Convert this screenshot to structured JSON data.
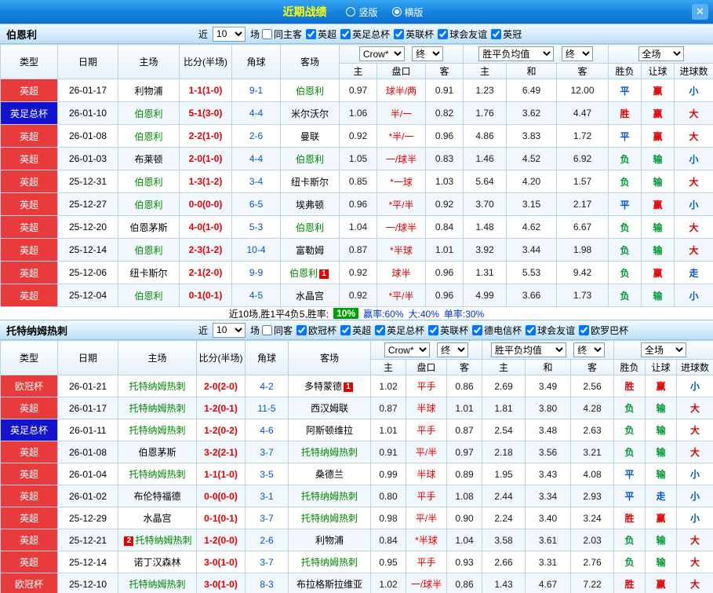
{
  "topbar": {
    "title": "近期战绩",
    "radios": [
      {
        "label": "竖版",
        "selected": false
      },
      {
        "label": "横版",
        "selected": true
      }
    ],
    "close": "✕"
  },
  "table_labels": {
    "col_type": "类型",
    "col_date": "日期",
    "col_home": "主场",
    "col_score": "比分(半场)",
    "col_corner": "角球",
    "col_away": "客场",
    "col_host": "主",
    "col_handicap": "盘口",
    "col_guest": "客",
    "col_draw": "和",
    "col_wdl": "胜负",
    "col_let": "让球",
    "col_goals": "进球数",
    "sel_bookmaker": "Crow*",
    "sel_final": "终",
    "sel_avg": "胜平负均值",
    "sel_scope": "全场",
    "near": "近",
    "games": "场"
  },
  "sections": [
    {
      "team": "伯恩利",
      "count": "10",
      "filters": [
        {
          "label": "同主客",
          "checked": false
        },
        {
          "label": "英超",
          "checked": true
        },
        {
          "label": "英足总杯",
          "checked": true
        },
        {
          "label": "英联杯",
          "checked": true
        },
        {
          "label": "球会友谊",
          "checked": true
        },
        {
          "label": "英冠",
          "checked": true
        }
      ],
      "rows": [
        {
          "league": "英超",
          "lc": "r",
          "date": "26-01-17",
          "home": "利物浦",
          "hf": 0,
          "score": "1-1(1-0)",
          "corner": "9-1",
          "away": "伯恩利",
          "af": 1,
          "o1": "0.97",
          "pk": "球半/两",
          "o2": "0.91",
          "e1": "1.23",
          "e2": "6.49",
          "e3": "12.00",
          "r1": [
            "平",
            "b"
          ],
          "r2": [
            "赢",
            "r"
          ],
          "r3": [
            "小",
            "b"
          ]
        },
        {
          "league": "英足总杯",
          "lc": "u",
          "date": "26-01-10",
          "home": "伯恩利",
          "hf": 1,
          "score": "5-1(3-0)",
          "corner": "4-4",
          "away": "米尔沃尔",
          "af": 0,
          "o1": "1.06",
          "pk": "半/一",
          "o2": "0.82",
          "e1": "1.76",
          "e2": "3.62",
          "e3": "4.47",
          "r1": [
            "胜",
            "r"
          ],
          "r2": [
            "赢",
            "r"
          ],
          "r3": [
            "大",
            "r"
          ]
        },
        {
          "league": "英超",
          "lc": "r",
          "date": "26-01-08",
          "home": "伯恩利",
          "hf": 1,
          "score": "2-2(1-0)",
          "corner": "2-6",
          "away": "曼联",
          "af": 0,
          "o1": "0.92",
          "pk": "*半/一",
          "o2": "0.96",
          "e1": "4.86",
          "e2": "3.83",
          "e3": "1.72",
          "r1": [
            "平",
            "b"
          ],
          "r2": [
            "赢",
            "r"
          ],
          "r3": [
            "大",
            "r"
          ]
        },
        {
          "league": "英超",
          "lc": "r",
          "date": "26-01-03",
          "home": "布莱顿",
          "hf": 0,
          "score": "2-0(1-0)",
          "corner": "4-4",
          "away": "伯恩利",
          "af": 1,
          "o1": "1.05",
          "pk": "一/球半",
          "o2": "0.83",
          "e1": "1.46",
          "e2": "4.52",
          "e3": "6.92",
          "r1": [
            "负",
            "g"
          ],
          "r2": [
            "输",
            "g"
          ],
          "r3": [
            "小",
            "b"
          ]
        },
        {
          "league": "英超",
          "lc": "r",
          "date": "25-12-31",
          "home": "伯恩利",
          "hf": 1,
          "score": "1-3(1-2)",
          "corner": "3-4",
          "away": "纽卡斯尔",
          "af": 0,
          "o1": "0.85",
          "pk": "*一球",
          "o2": "1.03",
          "e1": "5.64",
          "e2": "4.20",
          "e3": "1.57",
          "r1": [
            "负",
            "g"
          ],
          "r2": [
            "输",
            "g"
          ],
          "r3": [
            "大",
            "r"
          ]
        },
        {
          "league": "英超",
          "lc": "r",
          "date": "25-12-27",
          "home": "伯恩利",
          "hf": 1,
          "score": "0-0(0-0)",
          "corner": "6-5",
          "away": "埃弗顿",
          "af": 0,
          "o1": "0.96",
          "pk": "*平/半",
          "o2": "0.92",
          "e1": "3.70",
          "e2": "3.15",
          "e3": "2.17",
          "r1": [
            "平",
            "b"
          ],
          "r2": [
            "赢",
            "r"
          ],
          "r3": [
            "小",
            "b"
          ]
        },
        {
          "league": "英超",
          "lc": "r",
          "date": "25-12-20",
          "home": "伯恩茅斯",
          "hf": 0,
          "score": "4-0(1-0)",
          "corner": "5-3",
          "away": "伯恩利",
          "af": 1,
          "o1": "1.04",
          "pk": "一/球半",
          "o2": "0.84",
          "e1": "1.48",
          "e2": "4.62",
          "e3": "6.67",
          "r1": [
            "负",
            "g"
          ],
          "r2": [
            "输",
            "g"
          ],
          "r3": [
            "大",
            "r"
          ]
        },
        {
          "league": "英超",
          "lc": "r",
          "date": "25-12-14",
          "home": "伯恩利",
          "hf": 1,
          "score": "2-3(1-2)",
          "corner": "10-4",
          "away": "富勒姆",
          "af": 0,
          "o1": "0.87",
          "pk": "*半球",
          "o2": "1.01",
          "e1": "3.92",
          "e2": "3.44",
          "e3": "1.98",
          "r1": [
            "负",
            "g"
          ],
          "r2": [
            "输",
            "g"
          ],
          "r3": [
            "大",
            "r"
          ]
        },
        {
          "league": "英超",
          "lc": "r",
          "date": "25-12-06",
          "home": "纽卡斯尔",
          "hf": 0,
          "score": "2-1(2-0)",
          "corner": "9-9",
          "away": "伯恩利",
          "af": 1,
          "abs": "1",
          "o1": "0.92",
          "pk": "球半",
          "o2": "0.96",
          "e1": "1.31",
          "e2": "5.53",
          "e3": "9.42",
          "r1": [
            "负",
            "g"
          ],
          "r2": [
            "赢",
            "r"
          ],
          "r3": [
            "走",
            "b"
          ]
        },
        {
          "league": "英超",
          "lc": "r",
          "date": "25-12-04",
          "home": "伯恩利",
          "hf": 1,
          "score": "0-1(0-1)",
          "corner": "4-5",
          "away": "水晶宫",
          "af": 0,
          "o1": "0.92",
          "pk": "*平/半",
          "o2": "0.96",
          "e1": "4.99",
          "e2": "3.66",
          "e3": "1.73",
          "r1": [
            "负",
            "g"
          ],
          "r2": [
            "输",
            "g"
          ],
          "r3": [
            "小",
            "b"
          ]
        }
      ],
      "footer": {
        "summary": "近10场,胜1平4负5,胜率:",
        "rate": "10%",
        "stats": [
          "赢率:60%",
          "大:40%",
          "单率:30%"
        ]
      }
    },
    {
      "team": "托特纳姆热刺",
      "count": "10",
      "filters": [
        {
          "label": "同客",
          "checked": false
        },
        {
          "label": "欧冠杯",
          "checked": true
        },
        {
          "label": "英超",
          "checked": true
        },
        {
          "label": "英足总杯",
          "checked": true
        },
        {
          "label": "英联杯",
          "checked": true
        },
        {
          "label": "德电信杯",
          "checked": true
        },
        {
          "label": "球会友谊",
          "checked": true
        },
        {
          "label": "欧罗巴杯",
          "checked": true
        }
      ],
      "rows": [
        {
          "league": "欧冠杯",
          "lc": "r",
          "date": "26-01-21",
          "home": "托特纳姆热刺",
          "hf": 1,
          "score": "2-0(2-0)",
          "corner": "4-2",
          "away": "多特蒙德",
          "af": 0,
          "abs": "1",
          "o1": "1.02",
          "pk": "平手",
          "o2": "0.86",
          "e1": "2.69",
          "e2": "3.49",
          "e3": "2.56",
          "r1": [
            "胜",
            "r"
          ],
          "r2": [
            "赢",
            "r"
          ],
          "r3": [
            "小",
            "b"
          ]
        },
        {
          "league": "英超",
          "lc": "r",
          "date": "26-01-17",
          "home": "托特纳姆热刺",
          "hf": 1,
          "score": "1-2(0-1)",
          "corner": "11-5",
          "away": "西汉姆联",
          "af": 0,
          "o1": "0.87",
          "pk": "半球",
          "o2": "1.01",
          "e1": "1.81",
          "e2": "3.80",
          "e3": "4.28",
          "r1": [
            "负",
            "g"
          ],
          "r2": [
            "输",
            "g"
          ],
          "r3": [
            "大",
            "r"
          ]
        },
        {
          "league": "英足总杯",
          "lc": "u",
          "date": "26-01-11",
          "home": "托特纳姆热刺",
          "hf": 1,
          "score": "1-2(0-2)",
          "corner": "4-6",
          "away": "阿斯顿维拉",
          "af": 0,
          "o1": "1.01",
          "pk": "平手",
          "o2": "0.87",
          "e1": "2.54",
          "e2": "3.48",
          "e3": "2.63",
          "r1": [
            "负",
            "g"
          ],
          "r2": [
            "输",
            "g"
          ],
          "r3": [
            "大",
            "r"
          ]
        },
        {
          "league": "英超",
          "lc": "r",
          "date": "26-01-08",
          "home": "伯恩茅斯",
          "hf": 0,
          "score": "3-2(2-1)",
          "corner": "3-7",
          "away": "托特纳姆热刺",
          "af": 1,
          "o1": "0.91",
          "pk": "平/半",
          "o2": "0.97",
          "e1": "2.18",
          "e2": "3.56",
          "e3": "3.21",
          "r1": [
            "负",
            "g"
          ],
          "r2": [
            "输",
            "g"
          ],
          "r3": [
            "大",
            "r"
          ]
        },
        {
          "league": "英超",
          "lc": "r",
          "date": "26-01-04",
          "home": "托特纳姆热刺",
          "hf": 1,
          "score": "1-1(1-0)",
          "corner": "3-5",
          "away": "桑德兰",
          "af": 0,
          "o1": "0.99",
          "pk": "半球",
          "o2": "0.89",
          "e1": "1.95",
          "e2": "3.43",
          "e3": "4.08",
          "r1": [
            "平",
            "b"
          ],
          "r2": [
            "输",
            "g"
          ],
          "r3": [
            "小",
            "b"
          ]
        },
        {
          "league": "英超",
          "lc": "r",
          "date": "26-01-02",
          "home": "布伦特福德",
          "hf": 0,
          "score": "0-0(0-0)",
          "corner": "3-1",
          "away": "托特纳姆热刺",
          "af": 1,
          "o1": "0.80",
          "pk": "平手",
          "o2": "1.08",
          "e1": "2.44",
          "e2": "3.34",
          "e3": "2.93",
          "r1": [
            "平",
            "b"
          ],
          "r2": [
            "走",
            "b"
          ],
          "r3": [
            "小",
            "b"
          ]
        },
        {
          "league": "英超",
          "lc": "r",
          "date": "25-12-29",
          "home": "水晶宫",
          "hf": 0,
          "score": "0-1(0-1)",
          "corner": "3-7",
          "away": "托特纳姆热刺",
          "af": 1,
          "o1": "0.98",
          "pk": "平/半",
          "o2": "0.90",
          "e1": "2.24",
          "e2": "3.40",
          "e3": "3.24",
          "r1": [
            "胜",
            "r"
          ],
          "r2": [
            "赢",
            "r"
          ],
          "r3": [
            "小",
            "b"
          ]
        },
        {
          "league": "英超",
          "lc": "r",
          "date": "25-12-21",
          "home": "托特纳姆热刺",
          "hf": 1,
          "hbp": "2",
          "score": "1-2(0-0)",
          "corner": "2-6",
          "away": "利物浦",
          "af": 0,
          "o1": "0.84",
          "pk": "*半球",
          "o2": "1.04",
          "e1": "3.58",
          "e2": "3.61",
          "e3": "2.03",
          "r1": [
            "负",
            "g"
          ],
          "r2": [
            "输",
            "g"
          ],
          "r3": [
            "大",
            "r"
          ]
        },
        {
          "league": "英超",
          "lc": "r",
          "date": "25-12-14",
          "home": "诺丁汉森林",
          "hf": 0,
          "score": "3-0(1-0)",
          "corner": "3-7",
          "away": "托特纳姆热刺",
          "af": 1,
          "o1": "0.95",
          "pk": "平手",
          "o2": "0.93",
          "e1": "2.66",
          "e2": "3.31",
          "e3": "2.76",
          "r1": [
            "负",
            "g"
          ],
          "r2": [
            "输",
            "g"
          ],
          "r3": [
            "大",
            "r"
          ]
        },
        {
          "league": "欧冠杯",
          "lc": "r",
          "date": "25-12-10",
          "home": "托特纳姆热刺",
          "hf": 1,
          "score": "3-0(1-0)",
          "corner": "8-3",
          "away": "布拉格斯拉维亚",
          "af": 0,
          "o1": "1.02",
          "pk": "一/球半",
          "o2": "0.86",
          "e1": "1.43",
          "e2": "4.67",
          "e3": "7.22",
          "r1": [
            "胜",
            "r"
          ],
          "r2": [
            "赢",
            "r"
          ],
          "r3": [
            "大",
            "r"
          ]
        }
      ],
      "footer": null
    }
  ]
}
